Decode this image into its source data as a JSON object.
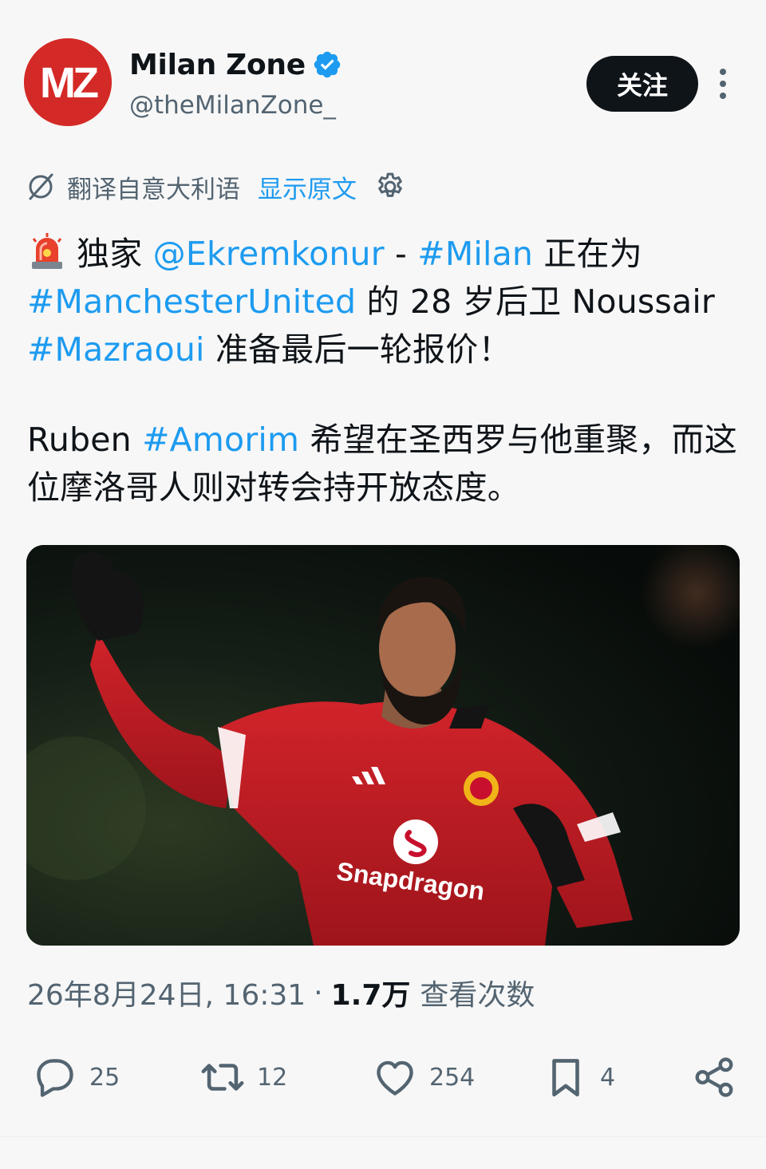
{
  "author": {
    "avatar_letters": "MZ",
    "name": "Milan Zone",
    "handle": "@theMilanZone_",
    "follow_label": "关注"
  },
  "translation": {
    "label": "翻译自意大利语",
    "show_original": "显示原文"
  },
  "tweet": {
    "p1": {
      "w1": "独家 ",
      "mention": "@Ekremkonur",
      "w2": " - ",
      "tag1": "#Milan",
      "w3": " 正在为 ",
      "tag2": "#ManchesterUnited",
      "w4": " 的 28 岁后卫 Noussair ",
      "tag3": "#Mazraoui",
      "w5": " 准备最后一轮报价！"
    },
    "p2": {
      "w1": "Ruben ",
      "tag1": "#Amorim",
      "w2": " 希望在圣西罗与他重聚，而这位摩洛哥人则对转会持开放态度。"
    }
  },
  "media": {
    "sponsor": "Snapdragon"
  },
  "meta": {
    "date_time": "26年8月24日, 16:31",
    "views_count": "1.7万",
    "views_label": "查看次数"
  },
  "actions": {
    "replies": "25",
    "retweets": "12",
    "likes": "254",
    "bookmarks": "4"
  },
  "colors": {
    "link": "#1d9bf0",
    "text": "#0f1419",
    "muted": "#536471",
    "brand_red": "#d42a27",
    "background": "#f7f7f7"
  }
}
